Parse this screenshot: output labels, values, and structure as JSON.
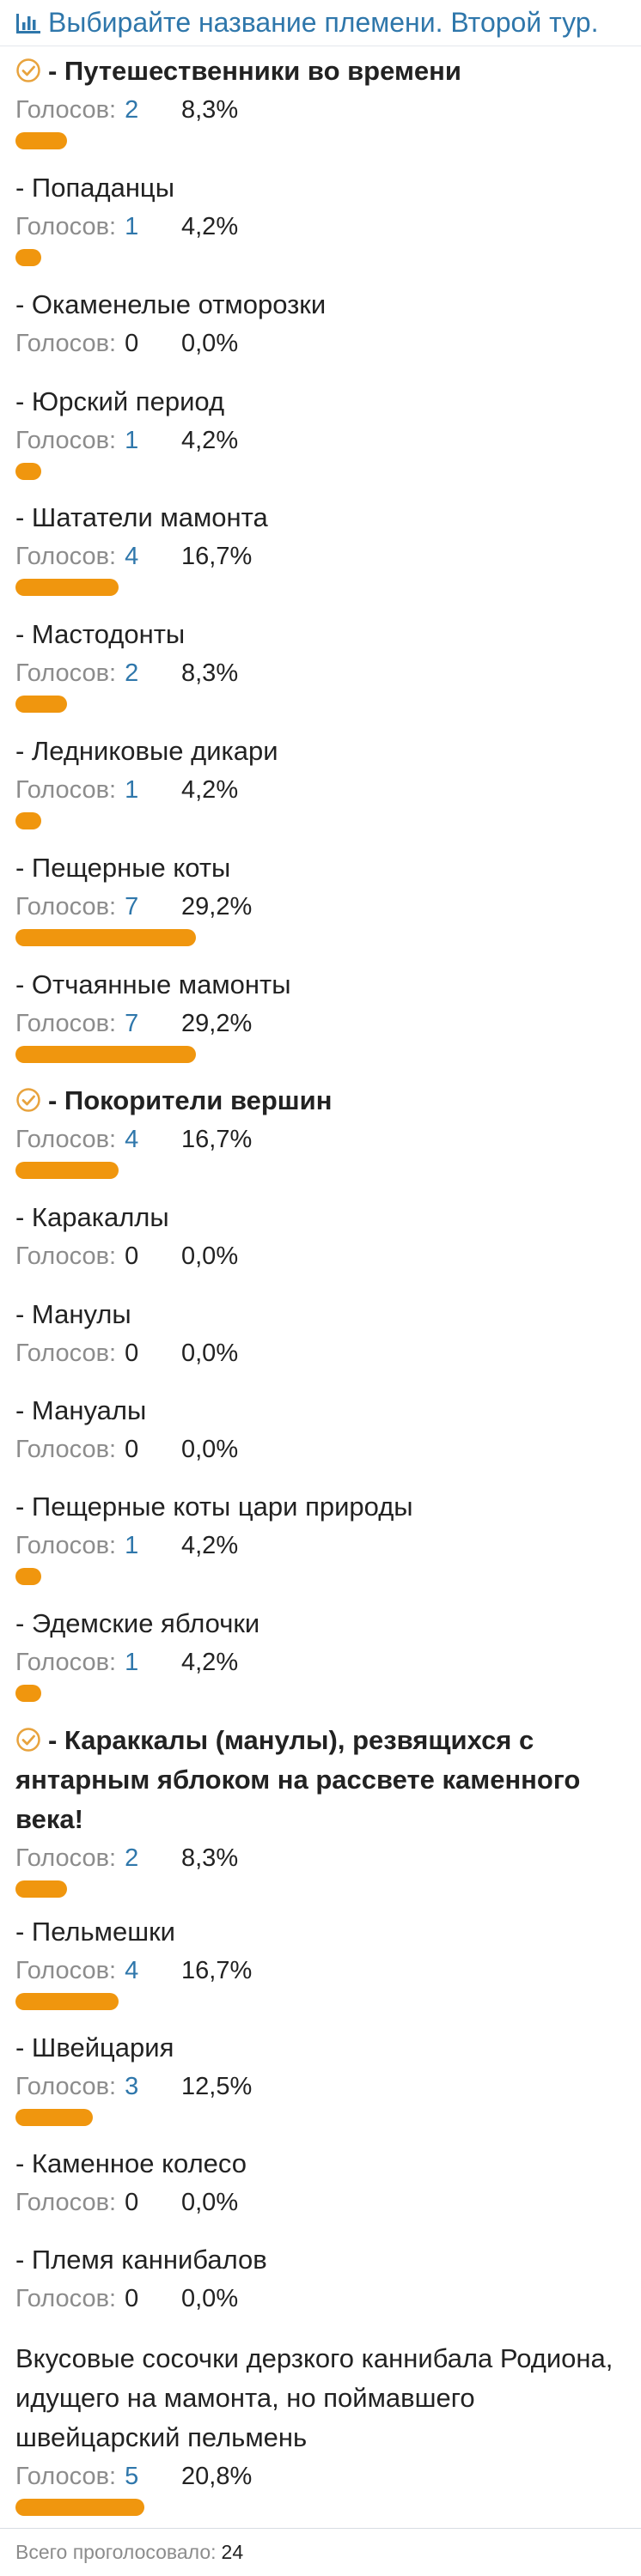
{
  "poll": {
    "title": "Выбирайте название племени. Второй тур.",
    "votes_label": "Голосов:",
    "total_label": "Всего проголосовало:",
    "total_votes": "24",
    "accent_color": "#f0960e",
    "link_color": "#2f77ab",
    "options": [
      {
        "title": "- Путешественники во времени",
        "votes": "2",
        "percent": "8,3%",
        "share": 8.3,
        "chosen": true
      },
      {
        "title": "- Попаданцы",
        "votes": "1",
        "percent": "4,2%",
        "share": 4.2,
        "chosen": false
      },
      {
        "title": "- Окаменелые отморозки",
        "votes": "0",
        "percent": "0,0%",
        "share": 0,
        "chosen": false
      },
      {
        "title": "- Юрский период",
        "votes": "1",
        "percent": "4,2%",
        "share": 4.2,
        "chosen": false
      },
      {
        "title": "- Шататели мамонта",
        "votes": "4",
        "percent": "16,7%",
        "share": 16.7,
        "chosen": false
      },
      {
        "title": "- Мастодонты",
        "votes": "2",
        "percent": "8,3%",
        "share": 8.3,
        "chosen": false
      },
      {
        "title": "- Ледниковые дикари",
        "votes": "1",
        "percent": "4,2%",
        "share": 4.2,
        "chosen": false
      },
      {
        "title": "- Пещерные коты",
        "votes": "7",
        "percent": "29,2%",
        "share": 29.2,
        "chosen": false
      },
      {
        "title": "- Отчаянные мамонты",
        "votes": "7",
        "percent": "29,2%",
        "share": 29.2,
        "chosen": false
      },
      {
        "title": "- Покорители вершин",
        "votes": "4",
        "percent": "16,7%",
        "share": 16.7,
        "chosen": true
      },
      {
        "title": "- Каракаллы",
        "votes": "0",
        "percent": "0,0%",
        "share": 0,
        "chosen": false
      },
      {
        "title": "- Манулы",
        "votes": "0",
        "percent": "0,0%",
        "share": 0,
        "chosen": false
      },
      {
        "title": "- Мануалы",
        "votes": "0",
        "percent": "0,0%",
        "share": 0,
        "chosen": false
      },
      {
        "title": "- Пещерные коты цари природы",
        "votes": "1",
        "percent": "4,2%",
        "share": 4.2,
        "chosen": false
      },
      {
        "title": "- Эдемские яблочки",
        "votes": "1",
        "percent": "4,2%",
        "share": 4.2,
        "chosen": false
      },
      {
        "title": "- Караккалы (манулы), резвящихся с янтарным яблоком на рассвете каменного века!",
        "votes": "2",
        "percent": "8,3%",
        "share": 8.3,
        "chosen": true
      },
      {
        "title": "- Пельмешки",
        "votes": "4",
        "percent": "16,7%",
        "share": 16.7,
        "chosen": false
      },
      {
        "title": "- Швейцария",
        "votes": "3",
        "percent": "12,5%",
        "share": 12.5,
        "chosen": false
      },
      {
        "title": "- Каменное колесо",
        "votes": "0",
        "percent": "0,0%",
        "share": 0,
        "chosen": false
      },
      {
        "title": "- Племя каннибалов",
        "votes": "0",
        "percent": "0,0%",
        "share": 0,
        "chosen": false
      },
      {
        "title": "Вкусовые сосочки дерзкого каннибала Родиона, идущего на мамонта, но поймавшего швейцарский пельмень",
        "votes": "5",
        "percent": "20,8%",
        "share": 20.8,
        "chosen": false
      }
    ]
  }
}
